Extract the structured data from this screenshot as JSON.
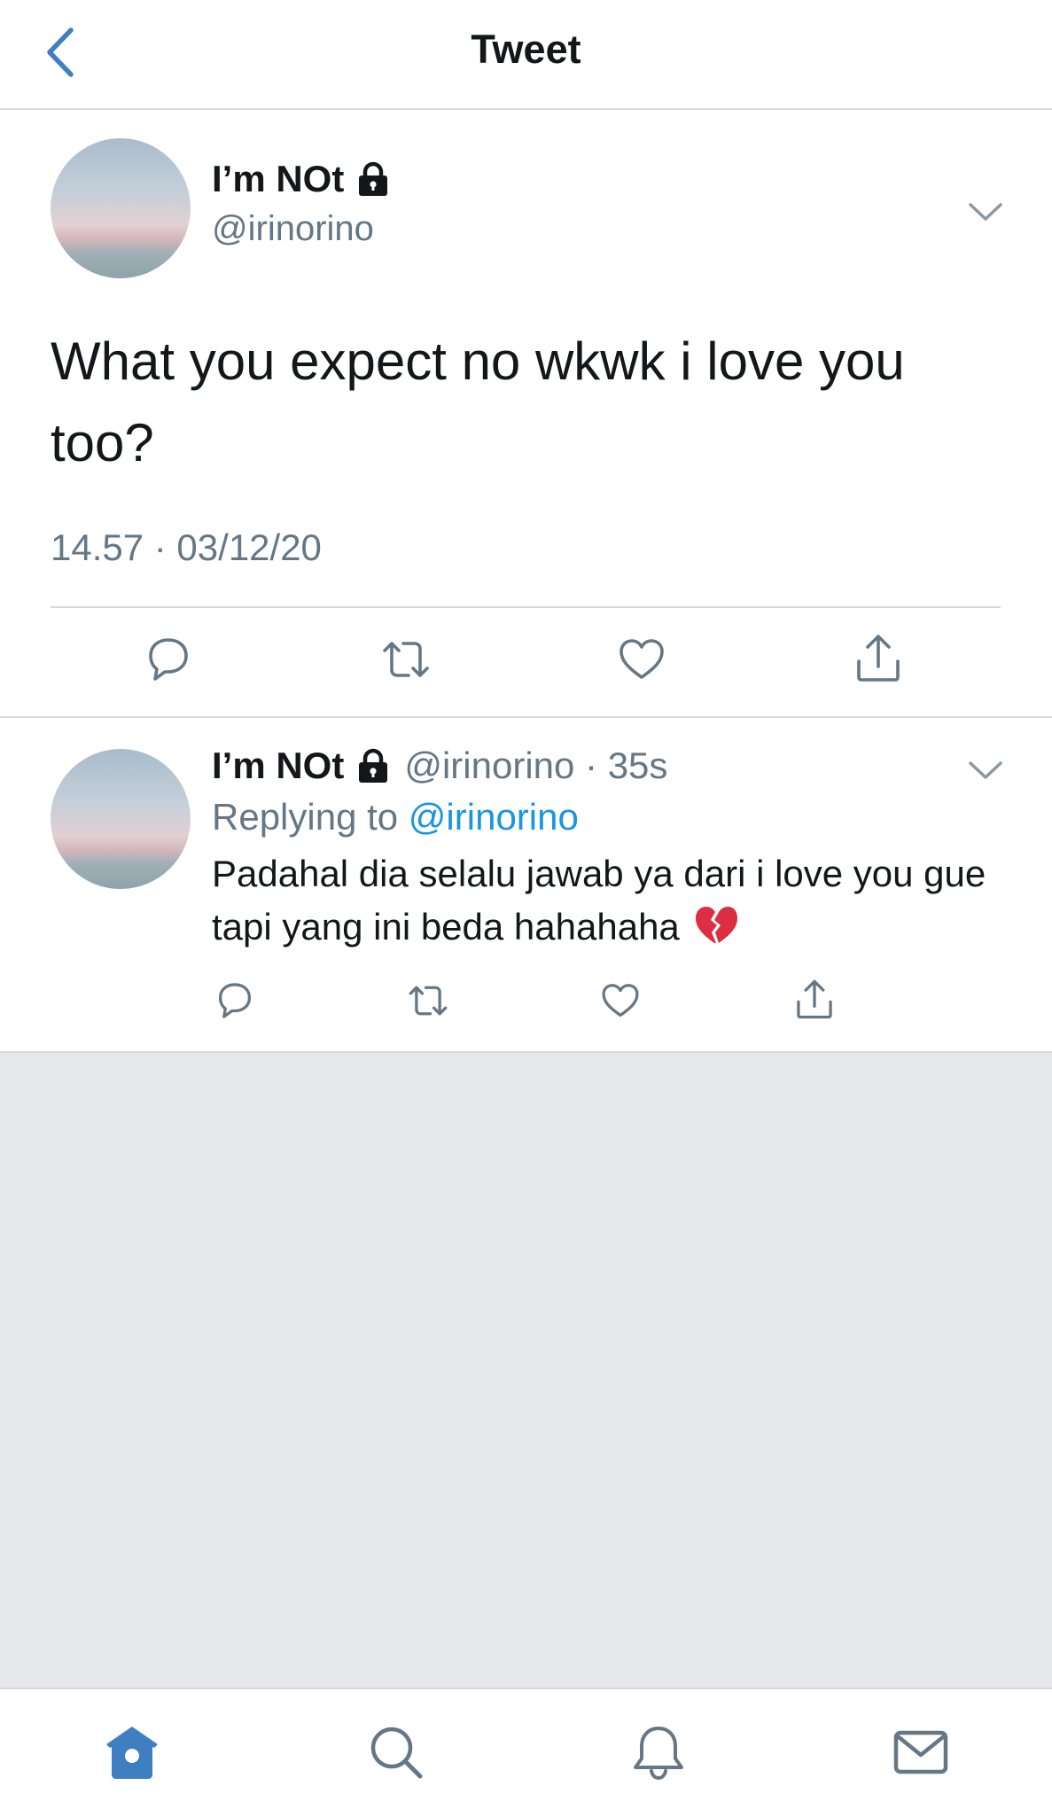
{
  "header": {
    "title": "Tweet"
  },
  "main_tweet": {
    "display_name": "I’m NOt",
    "handle": "@irinorino",
    "text": "What you expect no wkwk i love you too?",
    "time": "14.57 · 03/12/20"
  },
  "reply_tweet": {
    "display_name": "I’m NOt",
    "handle_time": "@irinorino · 35s",
    "replying_prefix": "Replying to",
    "replying_mention": "@irinorino",
    "text": "Padahal dia selalu jawab ya dari i love you gue tapi yang ini beda hahahaha"
  },
  "colors": {
    "accent": "#1da1f2",
    "icon_gray": "#657786",
    "divider": "#d6d9dc",
    "empty_bg": "#e6e8ec"
  },
  "icons": [
    "chevron-left-icon",
    "lock-icon",
    "chevron-down-icon",
    "reply-icon",
    "retweet-icon",
    "like-icon",
    "share-icon",
    "broken-heart-emoji",
    "home-icon",
    "search-icon",
    "notifications-icon",
    "messages-icon"
  ]
}
